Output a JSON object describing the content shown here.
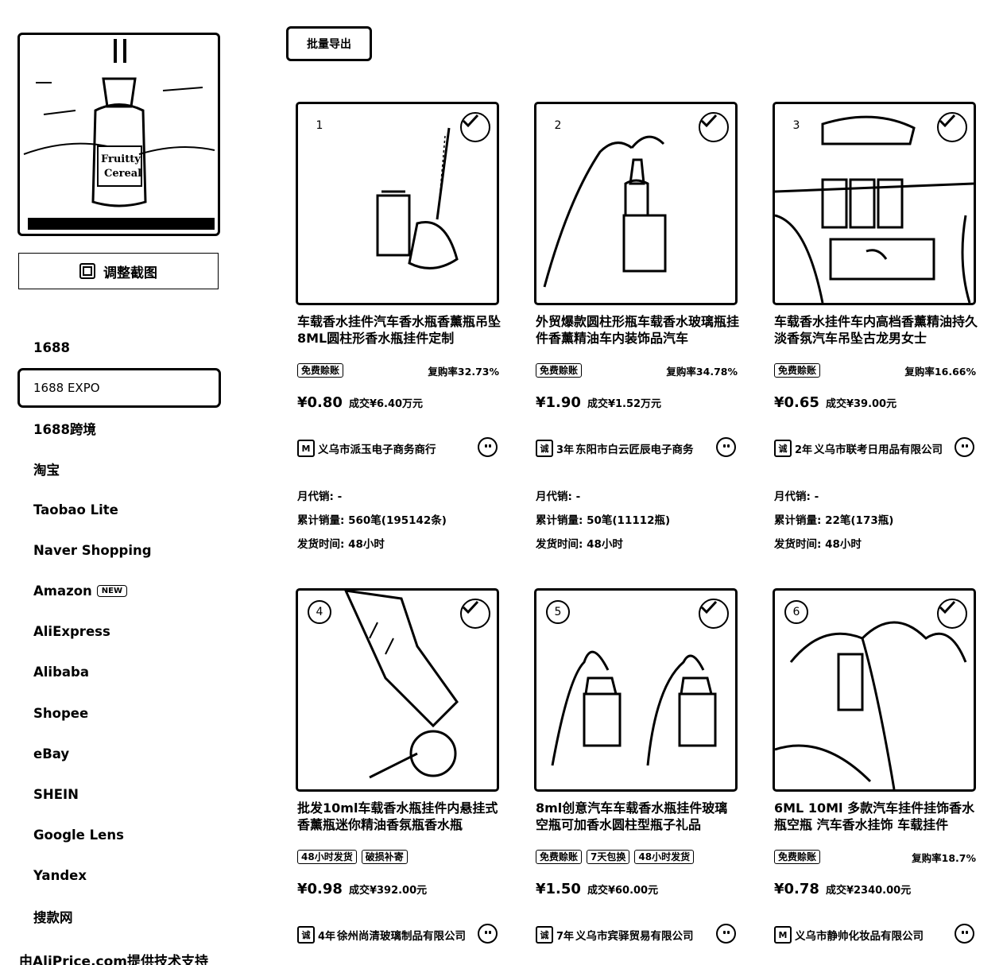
{
  "sidebar": {
    "adjust_button_label": "调整截图",
    "sources": [
      {
        "label": "1688"
      },
      {
        "label": "1688 EXPO",
        "active": true
      },
      {
        "label": "1688跨境"
      },
      {
        "label": "淘宝"
      },
      {
        "label": "Taobao Lite"
      },
      {
        "label": "Naver Shopping"
      },
      {
        "label": "Amazon",
        "badge": "NEW"
      },
      {
        "label": "AliExpress"
      },
      {
        "label": "Alibaba"
      },
      {
        "label": "Shopee"
      },
      {
        "label": "eBay"
      },
      {
        "label": "SHEIN"
      },
      {
        "label": "Google Lens"
      },
      {
        "label": "Yandex"
      },
      {
        "label": "搜款网"
      }
    ],
    "footer_credit": "由AliPrice.com提供技术支持"
  },
  "toolbar": {
    "export_label": "批量导出"
  },
  "products": [
    {
      "index": "1",
      "title": "车载香水挂件汽车香水瓶香薰瓶吊坠8ML圆柱形香水瓶挂件定制",
      "tags": [
        "免费赊账"
      ],
      "repeat_rate": "复购率32.73%",
      "price": "¥0.80",
      "deal": "成交¥6.40万元",
      "store_icon": "M",
      "store_years": "",
      "store_name": "义乌市派玉电子商务商行",
      "monthly": "月代销: -",
      "total": "累计销量: 560笔(195142条)",
      "ship": "发货时间: 48小时"
    },
    {
      "index": "2",
      "title": "外贸爆款圆柱形瓶车载香水玻璃瓶挂件香薰精油车内装饰品汽车",
      "tags": [
        "免费赊账"
      ],
      "repeat_rate": "复购率34.78%",
      "price": "¥1.90",
      "deal": "成交¥1.52万元",
      "store_icon": "诚",
      "store_years": "3年",
      "store_name": "东阳市白云匠辰电子商务",
      "monthly": "月代销: -",
      "total": "累计销量: 50笔(11112瓶)",
      "ship": "发货时间: 48小时"
    },
    {
      "index": "3",
      "title": "车载香水挂件车内高档香薰精油持久淡香氛汽车吊坠古龙男女士",
      "tags": [
        "免费赊账"
      ],
      "repeat_rate": "复购率16.66%",
      "price": "¥0.65",
      "deal": "成交¥39.00元",
      "store_icon": "诚",
      "store_years": "2年",
      "store_name": "义乌市联考日用品有限公司",
      "monthly": "月代销: -",
      "total": "累计销量: 22笔(173瓶)",
      "ship": "发货时间: 48小时"
    },
    {
      "index": "4",
      "title": "批发10ml车载香水瓶挂件内悬挂式香薰瓶迷你精油香氛瓶香水瓶",
      "tags": [
        "48小时发货",
        "破损补寄"
      ],
      "repeat_rate": "",
      "price": "¥0.98",
      "deal": "成交¥392.00元",
      "store_icon": "诚",
      "store_years": "4年",
      "store_name": "徐州尚清玻璃制品有限公司",
      "monthly": "",
      "total": "",
      "ship": ""
    },
    {
      "index": "5",
      "title": "8ml创意汽车车载香水瓶挂件玻璃空瓶可加香水圆柱型瓶子礼品",
      "tags": [
        "免费赊账",
        "7天包换",
        "48小时发货"
      ],
      "repeat_rate": "",
      "price": "¥1.50",
      "deal": "成交¥60.00元",
      "store_icon": "诚",
      "store_years": "7年",
      "store_name": "义乌市宾驿贸易有限公司",
      "monthly": "",
      "total": "",
      "ship": ""
    },
    {
      "index": "6",
      "title": "6ML 10Ml 多款汽车挂件挂饰香水瓶空瓶 汽车香水挂饰 车载挂件",
      "tags": [
        "免费赊账"
      ],
      "repeat_rate": "复购率18.7%",
      "price": "¥0.78",
      "deal": "成交¥2340.00元",
      "store_icon": "M",
      "store_years": "",
      "store_name": "义乌市静帅化妆品有限公司",
      "monthly": "",
      "total": "",
      "ship": ""
    }
  ],
  "icons": {
    "adjust": "crop-frame-icon",
    "check": "check-circle-icon",
    "chat": "chat-face-icon",
    "store": "store-badge-icon"
  }
}
